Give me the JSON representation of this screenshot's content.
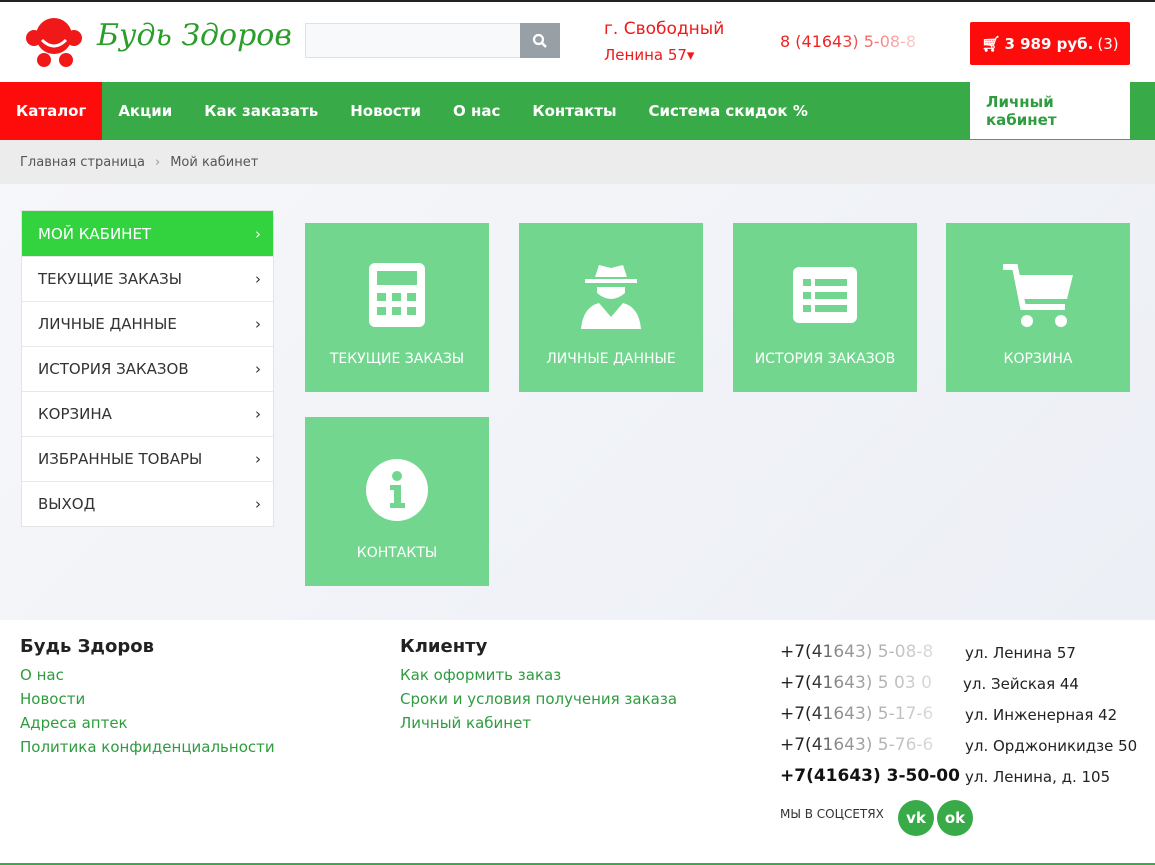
{
  "header": {
    "logo_text": "Будь Здоров",
    "search_placeholder": "",
    "city": "г. Свободный",
    "street": "Ленина 57",
    "phone": "8 (41643) 5-08-8",
    "cart": "3 989 руб.",
    "cart_count": "(3)"
  },
  "nav": {
    "items": [
      "Каталог",
      "Акции",
      "Как заказать",
      "Новости",
      "О нас",
      "Контакты",
      "Система скидок %"
    ],
    "account": "Личный кабинет"
  },
  "breadcrumb": [
    "Главная страница",
    "Мой кабинет"
  ],
  "sidebar": [
    "МОЙ КАБИНЕТ",
    "ТЕКУЩИЕ ЗАКАЗЫ",
    "ЛИЧНЫЕ ДАННЫЕ",
    "ИСТОРИЯ ЗАКАЗОВ",
    "КОРЗИНА",
    "ИЗБРАННЫЕ ТОВАРЫ",
    "ВЫХОД"
  ],
  "tiles": [
    "ТЕКУЩИЕ ЗАКАЗЫ",
    "ЛИЧНЫЕ ДАННЫЕ",
    "ИСТОРИЯ ЗАКАЗОВ",
    "КОРЗИНА",
    "КОНТАКТЫ"
  ],
  "footer": {
    "col1": {
      "title": "Будь Здоров",
      "links": [
        "О нас",
        "Новости",
        "Адреса аптек",
        "Политика конфиденциальности"
      ]
    },
    "col2": {
      "title": "Клиенту",
      "links": [
        "Как оформить заказ",
        "Сроки и условия получения заказа",
        "Личный кабинет"
      ]
    },
    "phones": [
      {
        "phone": "+7(41643) 5-08-8",
        "addr": "ул. Ленина 57"
      },
      {
        "phone": "+7(41643) 5 03 0",
        "addr": "ул. Зейская 44"
      },
      {
        "phone": "+7(41643) 5-17-6",
        "addr": "ул. Инженерная 42"
      },
      {
        "phone": "+7(41643) 5-76-6",
        "addr": "ул. Орджоникидзе 50"
      },
      {
        "phone": "+7(41643) 3-50-00",
        "addr": "ул. Ленина, д. 105"
      }
    ],
    "social": "МЫ В СОЦСЕТЯХ",
    "vk": "vk",
    "ok": "ok"
  },
  "colors": {
    "green": "#38ab48",
    "red": "#fe0c0c",
    "tile": "#73d68e"
  }
}
